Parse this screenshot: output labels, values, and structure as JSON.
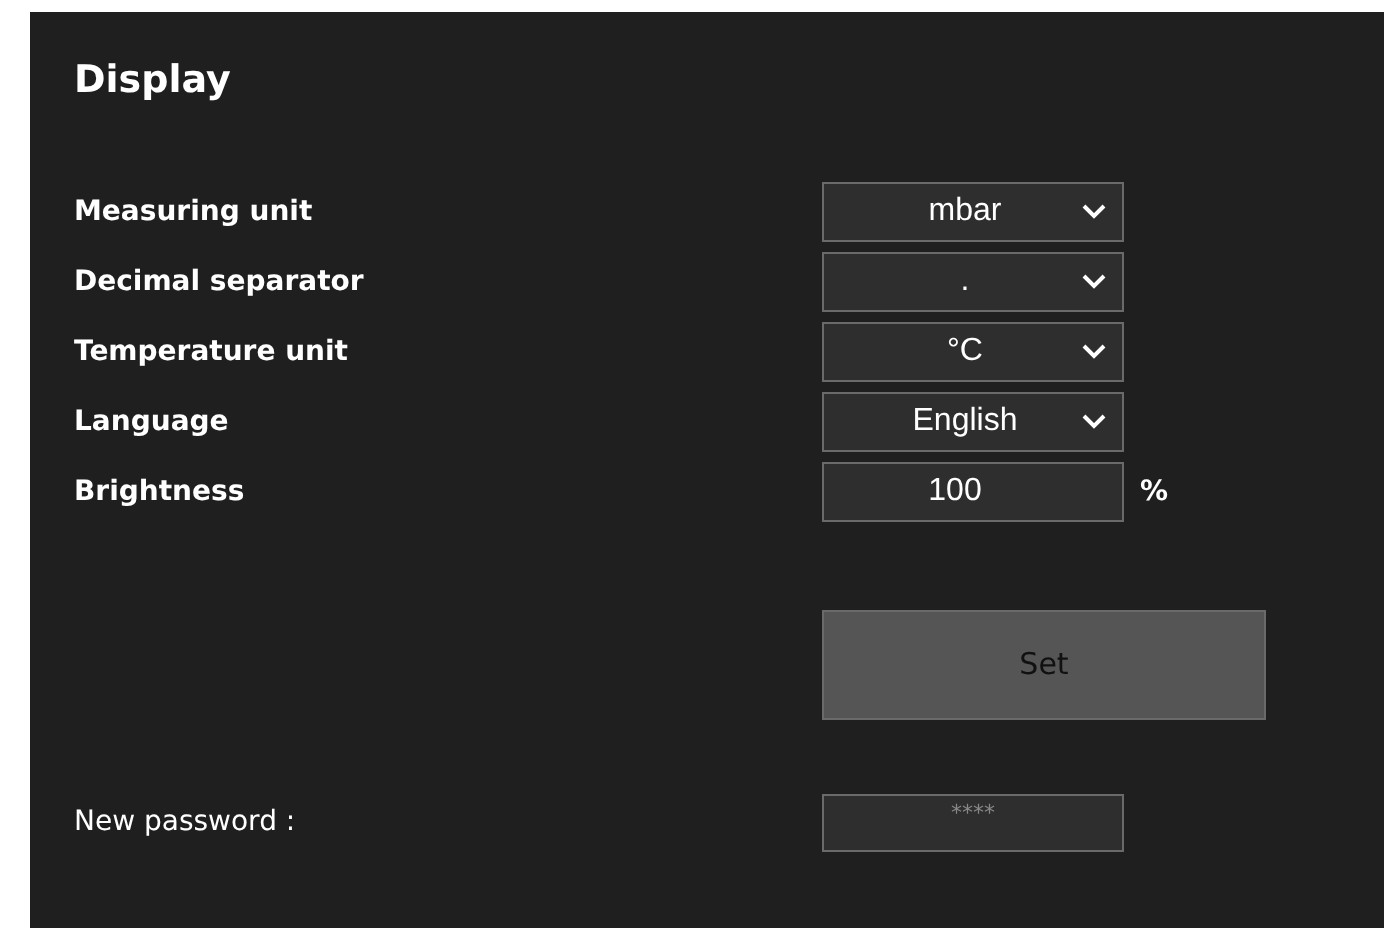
{
  "title": "Display",
  "settings": [
    {
      "label": "Measuring unit",
      "kind": "select",
      "value": "mbar"
    },
    {
      "label": "Decimal separator",
      "kind": "select",
      "value": "."
    },
    {
      "label": "Temperature unit",
      "kind": "select",
      "value": "°C"
    },
    {
      "label": "Language",
      "kind": "select",
      "value": "English"
    },
    {
      "label": "Brightness",
      "kind": "number",
      "value": "100",
      "unit": "%"
    }
  ],
  "set_button": "Set",
  "password": {
    "label": "New password :",
    "placeholder": "****"
  }
}
